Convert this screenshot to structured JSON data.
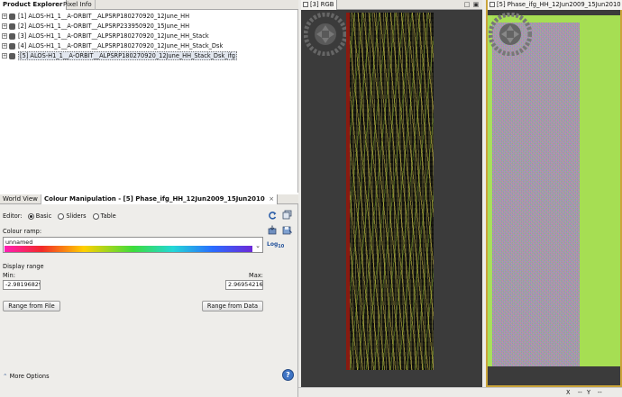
{
  "left_top_tabs": [
    {
      "label": "Product Explorer",
      "active": true
    },
    {
      "label": "Pixel Info",
      "active": false
    }
  ],
  "products": [
    {
      "label": "[1] ALOS-H1_1__A-ORBIT__ALPSRP180270920_12June_HH",
      "selected": false
    },
    {
      "label": "[2] ALOS-H1_1__A-ORBIT__ALPSRP233950920_15June_HH",
      "selected": false
    },
    {
      "label": "[3] ALOS-H1_1__A-ORBIT__ALPSRP180270920_12June_HH_Stack",
      "selected": false
    },
    {
      "label": "[4] ALOS-H1_1__A-ORBIT__ALPSRP180270920_12June_HH_Stack_Dsk",
      "selected": false
    },
    {
      "label": "[5] ALOS-H1_1__A-ORBIT__ALPSRP180270920_12June_HH_Stack_Dsk_ifg",
      "selected": true
    }
  ],
  "left_bottom_tabs": [
    {
      "label": "World View",
      "active": false
    },
    {
      "label": "Colour Manipulation - [5] Phase_ifg_HH_12Jun2009_15Jun2010",
      "active": true,
      "close": "×"
    }
  ],
  "colour": {
    "editor_label": "Editor:",
    "modes": [
      {
        "label": "Basic",
        "checked": true
      },
      {
        "label": "Sliders",
        "checked": false
      },
      {
        "label": "Table",
        "checked": false
      }
    ],
    "ramp_label": "Colour ramp:",
    "ramp_name": "unnamed",
    "log_label": "Log",
    "log_sub": "10",
    "display_range_label": "Display range",
    "min_label": "Min:",
    "max_label": "Max:",
    "min_value": "-2.98196829:",
    "max_value": "2.969542169",
    "range_from_file": "Range from File",
    "range_from_data": "Range from Data",
    "more_options": "More Options",
    "help": "?"
  },
  "views": {
    "rgb_title": "[3] RGB",
    "phase_title": "[5] Phase_ifg_HH_12Jun2009_15Jun2010"
  },
  "status": {
    "x_label": "X",
    "x_value": "--",
    "y_label": "Y",
    "y_value": "--"
  },
  "colors": {
    "phase_view_border": "#caa43a",
    "phase_green": "#a6de53"
  }
}
